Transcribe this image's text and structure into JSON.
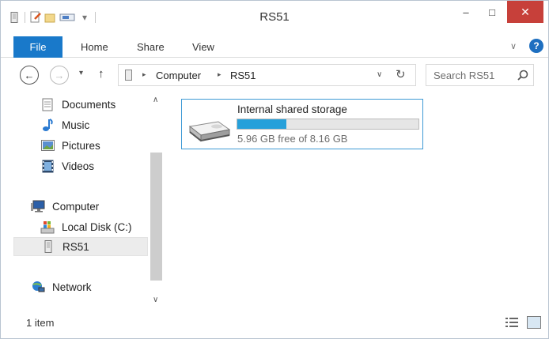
{
  "window": {
    "title": "RS51",
    "controls": {
      "minimize": "–",
      "maximize": "□",
      "close": "✕"
    }
  },
  "quick_access": {
    "customize_glyph": "▾"
  },
  "ribbon": {
    "tabs": [
      {
        "label": "File",
        "active": true
      },
      {
        "label": "Home"
      },
      {
        "label": "Share"
      },
      {
        "label": "View"
      }
    ],
    "expand_glyph": "∨",
    "help_glyph": "?"
  },
  "navigation": {
    "back_glyph": "←",
    "forward_glyph": "→",
    "recent_glyph": "▾",
    "up_glyph": "↑",
    "address": {
      "segments": [
        "Computer",
        "RS51"
      ],
      "separator": "▸",
      "dropdown_glyph": "∨",
      "refresh_glyph": "↻"
    },
    "search": {
      "placeholder": "Search RS51",
      "value": ""
    }
  },
  "sidebar": {
    "items": [
      {
        "label": "Documents",
        "icon": "documents-icon"
      },
      {
        "label": "Music",
        "icon": "music-icon"
      },
      {
        "label": "Pictures",
        "icon": "pictures-icon"
      },
      {
        "label": "Videos",
        "icon": "videos-icon"
      },
      {
        "label": "Computer",
        "icon": "computer-icon"
      },
      {
        "label": "Local Disk (C:)",
        "icon": "local-disk-icon"
      },
      {
        "label": "RS51",
        "icon": "portable-device-icon",
        "selected": true
      },
      {
        "label": "Network",
        "icon": "network-icon"
      }
    ],
    "scroll_up_glyph": "∧",
    "scroll_down_glyph": "∨"
  },
  "content": {
    "items": [
      {
        "name": "Internal shared storage",
        "free_text": "5.96 GB free of 8.16 GB",
        "used_fraction": 0.27,
        "icon": "drive-icon"
      }
    ]
  },
  "status_bar": {
    "item_count": "1 item"
  },
  "colors": {
    "accent": "#1979ca",
    "selection_border": "#3e9ad5",
    "progress": "#26a0da",
    "close": "#c7403a"
  }
}
